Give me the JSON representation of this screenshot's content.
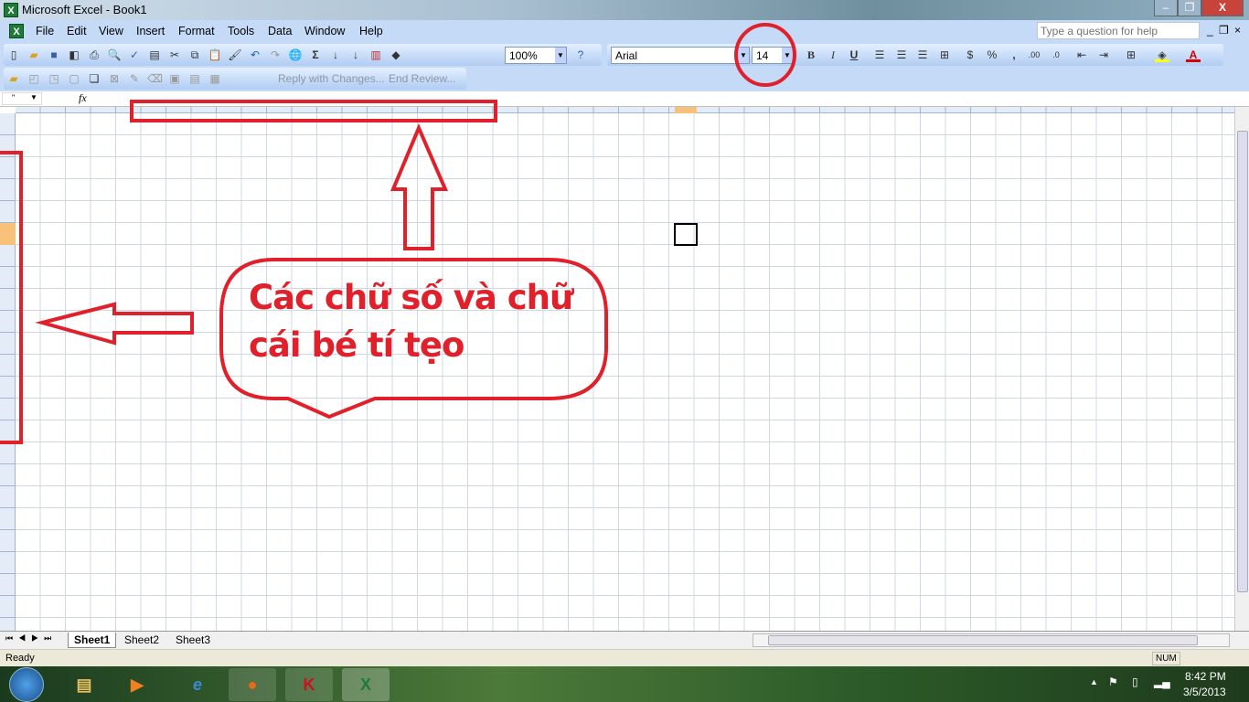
{
  "window": {
    "title": "Microsoft Excel - Book1",
    "min": "–",
    "restore": "❐",
    "close": "X"
  },
  "menu": {
    "items": [
      "File",
      "Edit",
      "View",
      "Insert",
      "Format",
      "Tools",
      "Data",
      "Window",
      "Help"
    ],
    "help_placeholder": "Type a question for help"
  },
  "toolbar": {
    "zoom": "100%",
    "font": "Arial",
    "font_size": "14",
    "bold": "B",
    "italic": "I",
    "underline": "U",
    "currency": "$",
    "percent": "%",
    "comma": ",",
    "reply": "Reply with Changes...",
    "end_review": "End Review..."
  },
  "formula_bar": {
    "name_box": "\"",
    "fx": "fx"
  },
  "sheets": {
    "tabs": [
      "Sheet1",
      "Sheet2",
      "Sheet3"
    ],
    "active": "Sheet1"
  },
  "status": {
    "text": "Ready",
    "num": "NUM"
  },
  "annotation": {
    "callout": "Các chữ số và chữ cái bé tí tẹo",
    "color": "#e0202a"
  },
  "taskbar": {
    "time": "8:42 PM",
    "date": "3/5/2013"
  }
}
